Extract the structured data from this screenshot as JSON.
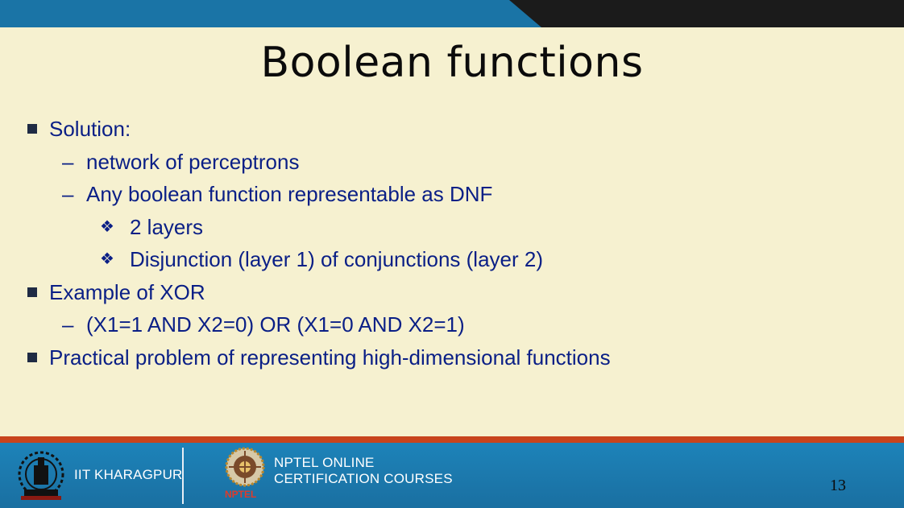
{
  "slide": {
    "title": "Boolean functions",
    "bullets": [
      {
        "marker": "",
        "text": "Solution:"
      },
      {
        "marker": "–",
        "text": "network of perceptrons"
      },
      {
        "marker": "–",
        "text": "Any boolean function representable as DNF"
      },
      {
        "marker": "❖",
        "text": "2 layers"
      },
      {
        "marker": "❖",
        "text": "Disjunction (layer 1) of conjunctions (layer 2)"
      },
      {
        "marker": "",
        "text": "Example of XOR"
      },
      {
        "marker": "–",
        "text": "(X1=1 AND X2=0) OR (X1=0 AND X2=1)"
      },
      {
        "marker": "",
        "text": "Practical problem of representing high-dimensional functions"
      }
    ],
    "page_number": "13"
  },
  "footer": {
    "institute": "IIT KHARAGPUR",
    "program_line1": "NPTEL ONLINE",
    "program_line2": "CERTIFICATION COURSES",
    "nptel_label": "NPTEL"
  },
  "colors": {
    "background": "#f6f1d0",
    "bullet_text": "#0a1f86",
    "top_bar": "#1a74a6",
    "footer": "#1d83b9",
    "stripe": "#c8441c"
  },
  "icons": [
    "iit-kharagpur-logo-icon",
    "nptel-logo-icon",
    "square-bullet-icon",
    "diamond-bullet-icon"
  ]
}
